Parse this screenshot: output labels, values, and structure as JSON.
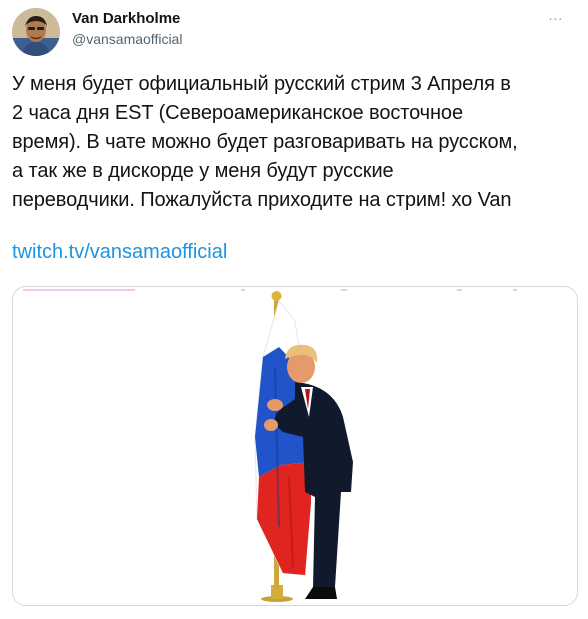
{
  "tweet": {
    "author": {
      "display_name": "Van Darkholme",
      "handle": "@vansamaofficial"
    },
    "more_label": "∙∙∙",
    "text_lines": [
      "У меня будет официальный русский стрим 3 Апреля в",
      "2 часа дня EST (Североамериканское восточное",
      "время). В чате можно будет разговаривать на русском,",
      "а так же в дискорде у меня будут русские",
      "переводчики. Пожалуйста приходите на стрим! хо Van"
    ],
    "link": "twitch.tv/vansamaofficial",
    "media": {
      "icon": "flag-hug-image",
      "flag_colors": [
        "#ffffff",
        "#1a4fc4",
        "#e02020"
      ]
    }
  }
}
